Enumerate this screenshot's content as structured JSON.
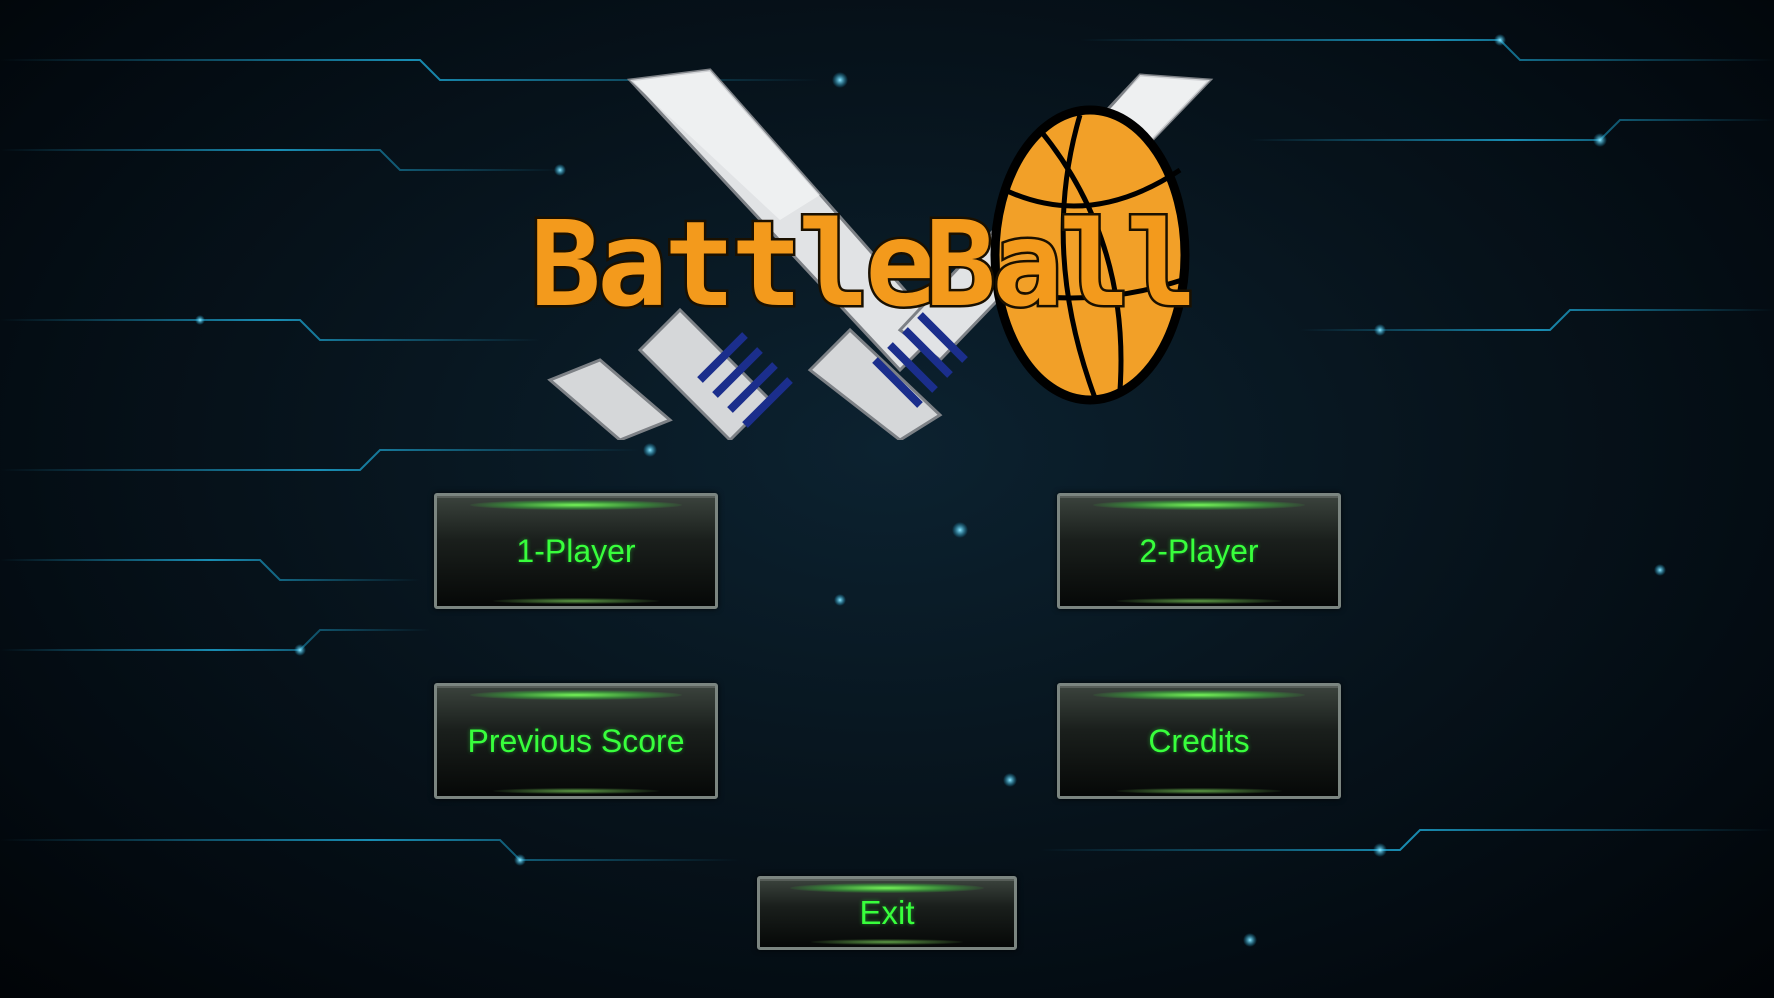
{
  "logo": {
    "title_word_1": "Battle",
    "title_word_2": "Ball",
    "colors": {
      "title_fill": "#f39a1c",
      "title_outline": "#1a1000",
      "ball": "#f2a028",
      "sword_blade": "#d8dadc",
      "sword_grip": "#1b2e8c"
    }
  },
  "menu": {
    "one_player": "1-Player",
    "two_player": "2-Player",
    "previous_score": "Previous Score",
    "credits": "Credits",
    "exit": "Exit"
  },
  "theme": {
    "button_text_color": "#38ff3c",
    "background_line_cyan": "#1fb6e6",
    "background_line_green": "#6fd84a"
  }
}
